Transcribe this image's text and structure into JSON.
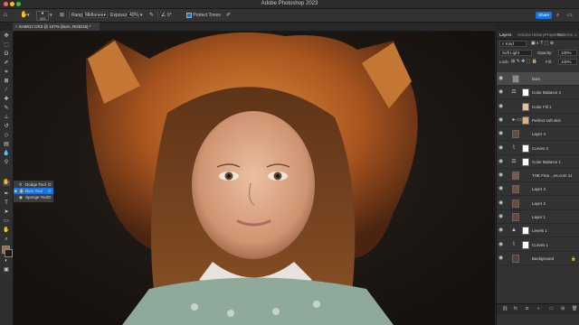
{
  "window": {
    "title": "Adobe Photoshop 2023"
  },
  "options_bar": {
    "range_label": "Range:",
    "range_value": "Midtones",
    "exposure_label": "Exposure:",
    "exposure_value": "40%",
    "protect_tones_label": "Protect Tones",
    "brush_size": "300",
    "share_label": "Share"
  },
  "document": {
    "tab_title": "SA9817.CR3 @ 107% (burn, RGB/16) *"
  },
  "tool_flyout": {
    "items": [
      {
        "label": "Dodge Tool",
        "key": "O"
      },
      {
        "label": "Burn Tool",
        "key": "O"
      },
      {
        "label": "Sponge Tool",
        "key": "O"
      }
    ]
  },
  "colors": {
    "foreground": "#b8652a",
    "background": "#1a1a1a",
    "accent": "#1473e6"
  },
  "panels": {
    "tabs": [
      "Layers",
      "Actions",
      "History",
      "Properties",
      "Patterns"
    ],
    "kind_label": "Kind",
    "blend_mode": "Soft Light",
    "opacity_label": "Opacity:",
    "opacity_value": "100%",
    "lock_label": "Lock:",
    "fill_label": "Fill:",
    "fill_value": "100%"
  },
  "layers": [
    {
      "name": "burn",
      "type": "pixel",
      "thumb_color": "#8a8a8a",
      "selected": true
    },
    {
      "name": "Color Balance 2",
      "type": "adjustment",
      "icon": "balance-icon",
      "thumb_color": "#ffffff"
    },
    {
      "name": "Color Fill 1",
      "type": "fill",
      "thumb_color": "#e8c29a"
    },
    {
      "name": "Perfect soft skin",
      "type": "group",
      "thumb_color": "#d9b48a"
    },
    {
      "name": "Layer 4",
      "type": "pixel",
      "thumb_color": "#6a4a35"
    },
    {
      "name": "Curves 2",
      "type": "adjustment",
      "icon": "curves-icon",
      "thumb_color": "#ffffff"
    },
    {
      "name": "Color Balance 1",
      "type": "adjustment",
      "icon": "balance-icon",
      "thumb_color": "#ffffff"
    },
    {
      "name": "THE Fina ...es.com 11",
      "type": "pixel",
      "thumb_color": "#7a5a45"
    },
    {
      "name": "Layer 3",
      "type": "pixel",
      "thumb_color": "#6e5040"
    },
    {
      "name": "Layer 2",
      "type": "pixel",
      "thumb_color": "#6a4c3c"
    },
    {
      "name": "Layer 1",
      "type": "pixel",
      "thumb_color": "#654838"
    },
    {
      "name": "Levels 1",
      "type": "adjustment",
      "icon": "levels-icon",
      "thumb_color": "#ffffff"
    },
    {
      "name": "Curves 1",
      "type": "adjustment",
      "icon": "curves-icon",
      "thumb_color": "#ffffff"
    },
    {
      "name": "Background",
      "type": "pixel",
      "thumb_color": "#5a4030",
      "locked": true
    }
  ]
}
